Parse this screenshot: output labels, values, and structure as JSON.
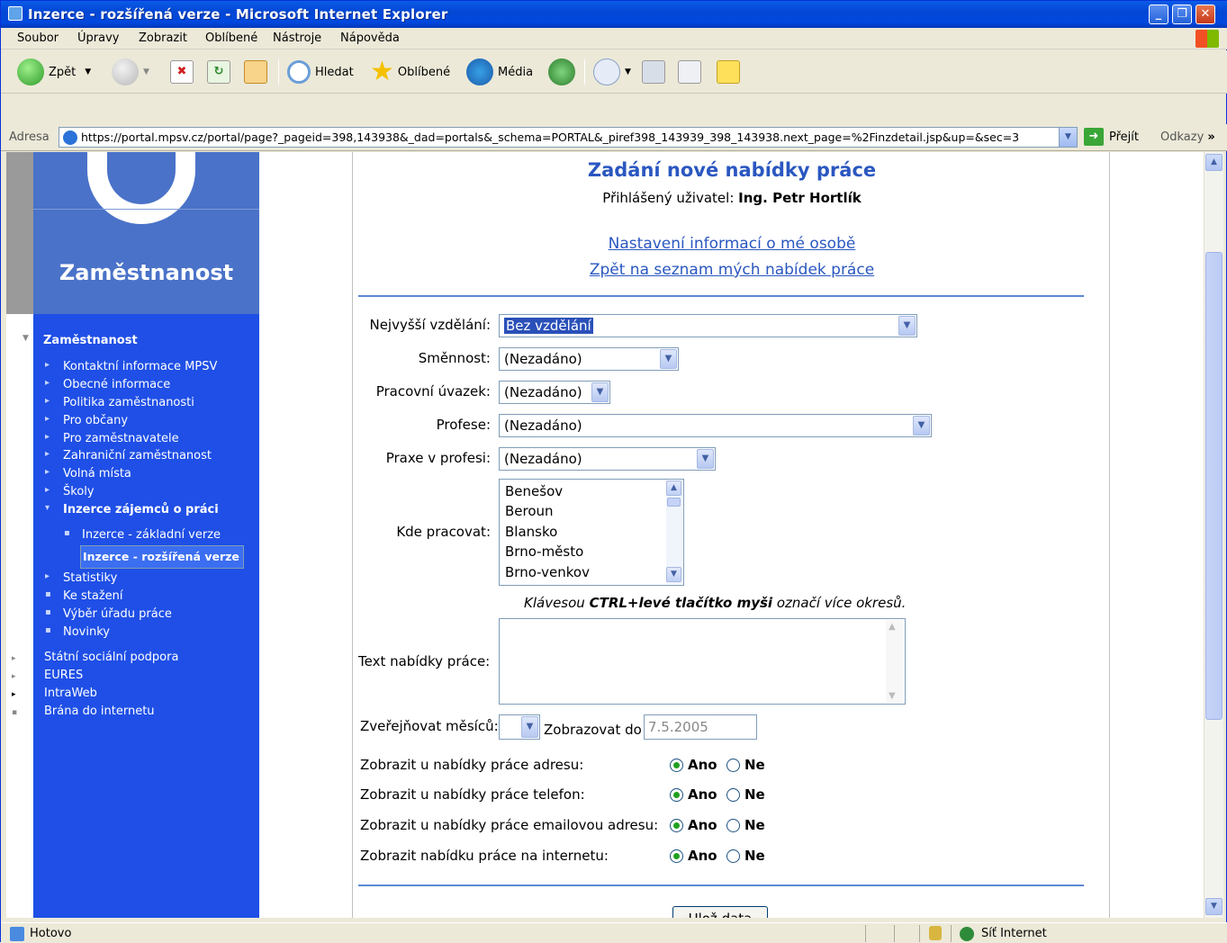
{
  "window": {
    "title": "Inzerce - rozšířená verze - Microsoft Internet Explorer"
  },
  "menu": [
    "Soubor",
    "Úpravy",
    "Zobrazit",
    "Oblíbené",
    "Nástroje",
    "Nápověda"
  ],
  "toolbar": {
    "back": "Zpět",
    "search": "Hledat",
    "favorites": "Oblíbené",
    "media": "Média"
  },
  "address": {
    "label": "Adresa",
    "url": "https://portal.mpsv.cz/portal/page?_pageid=398,143938&_dad=portals&_schema=PORTAL&_piref398_143939_398_143938.next_page=%2Finzdetail.jsp&up=&sec=3",
    "go": "Přejít",
    "links": "Odkazy"
  },
  "sidebar": {
    "title": "Zaměstnanost",
    "section": "Zaměstnanost",
    "items": [
      "Kontaktní informace MPSV",
      "Obecné informace",
      "Politika zaměstnanosti",
      "Pro občany",
      "Pro zaměstnavatele",
      "Zahraniční zaměstnanost",
      "Volná místa",
      "Školy"
    ],
    "active_group": "Inzerce zájemců o práci",
    "sub_items": [
      "Inzerce - základní verze",
      "Inzerce - rozšířená verze"
    ],
    "items2": [
      "Statistiky",
      "Ke stažení",
      "Výběr úřadu práce",
      "Novinky"
    ],
    "outer": [
      "Státní sociální podpora",
      "EURES",
      "IntraWeb",
      "Brána do internetu"
    ]
  },
  "page": {
    "heading": "Zadání nové nabídky práce",
    "user_label": "Přihlášený uživatel:",
    "user_name": "Ing. Petr Hortlík",
    "link_settings": "Nastavení informací o mé osobě",
    "link_back": "Zpět na seznam mých nabídek práce"
  },
  "form": {
    "education_label": "Nejvyšší vzdělání:",
    "education_value": "Bez vzdělání",
    "shift_label": "Směnnost:",
    "shift_value": "(Nezadáno)",
    "workload_label": "Pracovní úvazek:",
    "workload_value": "(Nezadáno)",
    "profession_label": "Profese:",
    "profession_value": "(Nezadáno)",
    "experience_label": "Praxe v profesi:",
    "experience_value": "(Nezadáno)",
    "location_label": "Kde pracovat:",
    "locations": [
      "Benešov",
      "Beroun",
      "Blansko",
      "Brno-město",
      "Brno-venkov"
    ],
    "hint_pre": "Klávesou ",
    "hint_bold": "CTRL+levé tlačítko myši",
    "hint_post": " označí více okresů.",
    "text_label": "Text nabídky práce:",
    "publish_label": "Zveřejňovat měsíců:",
    "display_label": "Zobrazovat do",
    "display_value": "7.5.2005",
    "radio_rows": [
      {
        "label": "Zobrazit u nabídky práce adresu:",
        "yes": "Ano",
        "no": "Ne"
      },
      {
        "label": "Zobrazit u nabídky práce telefon:",
        "yes": "Ano",
        "no": "Ne"
      },
      {
        "label": "Zobrazit u nabídky práce emailovou adresu:",
        "yes": "Ano",
        "no": "Ne"
      },
      {
        "label": "Zobrazit nabídku práce na internetu:",
        "yes": "Ano",
        "no": "Ne"
      }
    ],
    "save_label": "Ulož data"
  },
  "status": {
    "text": "Hotovo",
    "zone": "Síť Internet"
  }
}
